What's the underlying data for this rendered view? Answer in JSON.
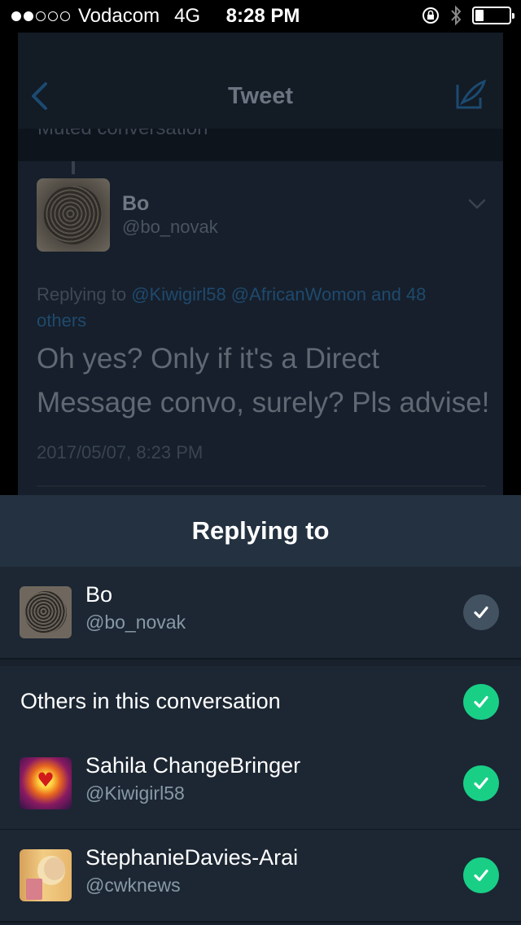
{
  "status_bar": {
    "carrier": "Vodacom",
    "network": "4G",
    "time": "8:28 PM",
    "signal_bars_filled": 2,
    "signal_bars_total": 5,
    "battery_level": 0.25
  },
  "background_tweet": {
    "nav_title": "Tweet",
    "muted_label": "Muted conversation",
    "author_name": "Bo",
    "author_handle": "@bo_novak",
    "replying_prefix": "Replying to",
    "replying_mentions": "@Kiwigirl58 @AfricanWomon and 48 others",
    "text": "Oh yes? Only if it's a Direct Message convo, surely? Pls advise!",
    "date": "2017/05/07, 8:23 PM"
  },
  "sheet": {
    "title": "Replying to",
    "primary": {
      "name": "Bo",
      "handle": "@bo_novak",
      "checked": true
    },
    "others_label": "Others in this conversation",
    "others_checked": true,
    "others": [
      {
        "name": "Sahila ChangeBringer",
        "handle": "@Kiwigirl58",
        "checked": true
      },
      {
        "name": "StephanieDavies-Arai",
        "handle": "@cwknews",
        "checked": true
      }
    ]
  },
  "colors": {
    "accent_blue": "#1da1f2",
    "check_green": "#19cf86",
    "check_gray": "#435261",
    "sheet_background": "#1c2733",
    "sheet_header": "#233140"
  }
}
